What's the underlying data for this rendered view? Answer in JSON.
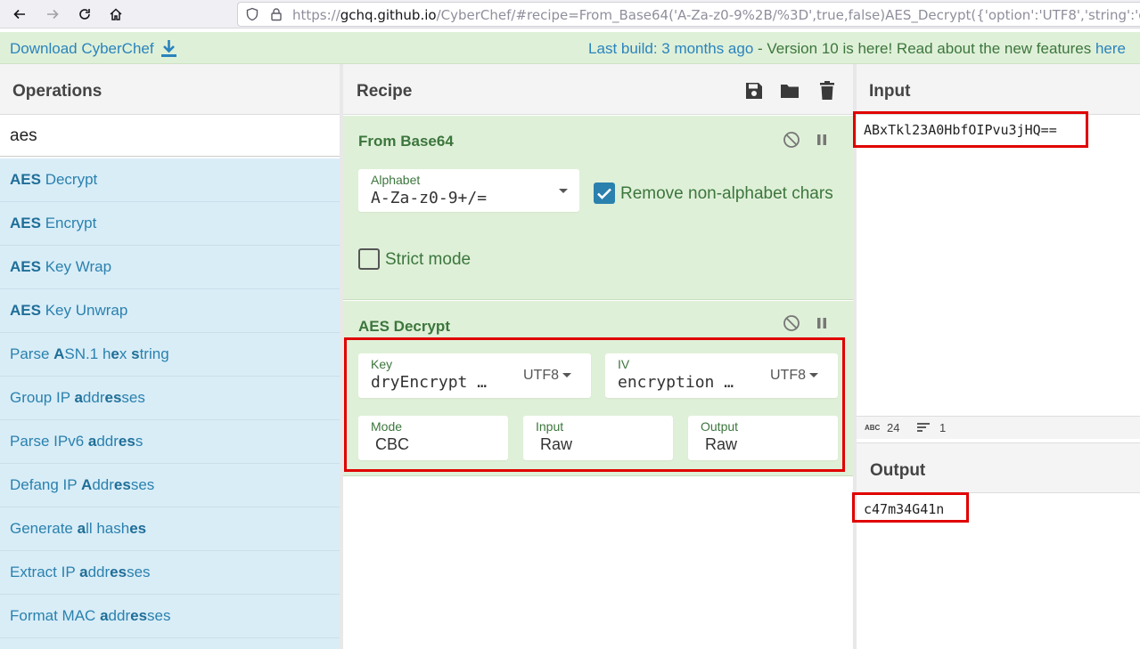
{
  "browser": {
    "url_scheme": "https://",
    "url_host": "gchq.github.io",
    "url_rest": "/CyberChef/#recipe=From_Base64('A-Za-z0-9%2B/%3D',true,false)AES_Decrypt({'option':'UTF8','string':'dryEncrypt"
  },
  "banner": {
    "download_label": "Download CyberChef",
    "build_prefix": "Last build: 3 months ago",
    "build_middle": " - Version 10 is here! Read about the new features ",
    "build_link": "here"
  },
  "operations": {
    "title": "Operations",
    "search_value": "aes",
    "items": [
      {
        "html": "<b>AES</b> Decrypt"
      },
      {
        "html": "<b>AES</b> Encrypt"
      },
      {
        "html": "<b>AES</b> Key Wrap"
      },
      {
        "html": "<b>AES</b> Key Unwrap"
      },
      {
        "html": "Parse <b>A</b>SN.1 h<b>e</b>x <b>s</b>tring"
      },
      {
        "html": "Group IP <b>a</b>ddr<b>es</b>ses"
      },
      {
        "html": "Parse IPv6 <b>a</b>ddr<b>es</b>s"
      },
      {
        "html": "Defang IP <b>A</b>ddr<b>es</b>ses"
      },
      {
        "html": "Generate <b>a</b>ll hash<b>es</b>"
      },
      {
        "html": "Extract IP <b>a</b>ddr<b>es</b>ses"
      },
      {
        "html": "Format MAC <b>a</b>ddr<b>es</b>ses"
      }
    ]
  },
  "recipe": {
    "title": "Recipe",
    "from_base64": {
      "title": "From Base64",
      "alphabet_label": "Alphabet",
      "alphabet_value": "A-Za-z0-9+/=",
      "remove_label": "Remove non-alphabet chars",
      "remove_checked": true,
      "strict_label": "Strict mode",
      "strict_checked": false
    },
    "aes_decrypt": {
      "title": "AES Decrypt",
      "key_label": "Key",
      "key_value": "dryEncrypt …",
      "key_encoding": "UTF8",
      "iv_label": "IV",
      "iv_value": "encryption …",
      "iv_encoding": "UTF8",
      "mode_label": "Mode",
      "mode_value": "CBC",
      "input_label": "Input",
      "input_value": "Raw",
      "output_label": "Output",
      "output_value": "Raw"
    }
  },
  "input": {
    "title": "Input",
    "value": "ABxTkl23A0HbfOIPvu3jHQ==",
    "length": "24",
    "lines": "1"
  },
  "output": {
    "title": "Output",
    "value": "c47m34G41n"
  },
  "colors": {
    "accent": "#2a81ae",
    "op_green": "#3c763d",
    "highlight": "#e00000"
  }
}
